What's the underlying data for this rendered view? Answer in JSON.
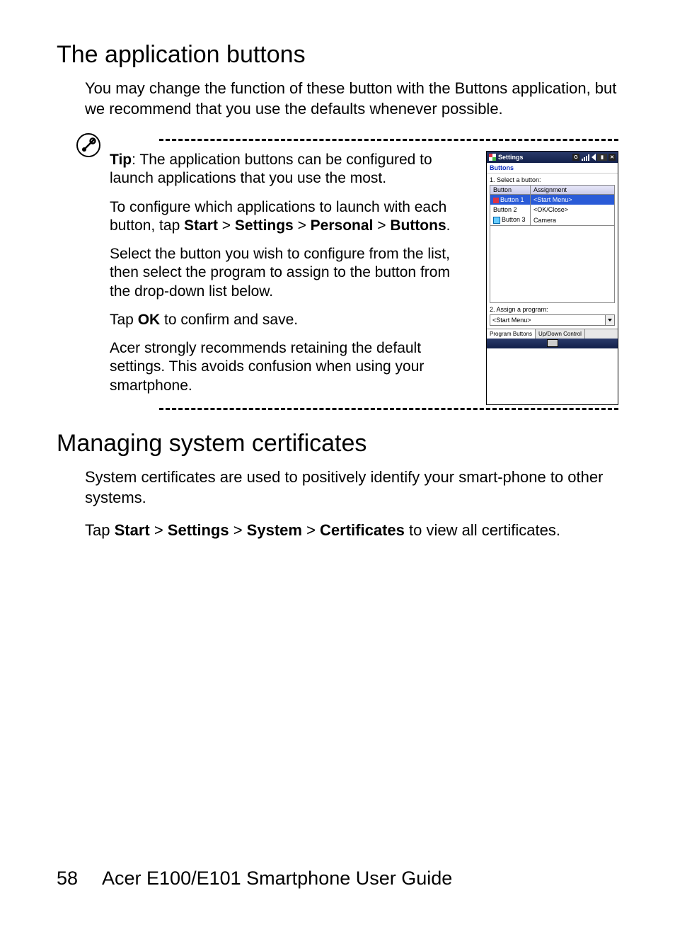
{
  "section1": {
    "heading": "The application buttons",
    "intro": "You may change the function of these button with the Buttons application, but we recommend that you use the defaults whenever possible."
  },
  "tip": {
    "label": "Tip",
    "p1_rest": ": The application buttons can be configured to launch applications that you use the most.",
    "p2_a": "To configure which applications to launch with each button, tap ",
    "p2_nav1": "Start",
    "p2_sep": " > ",
    "p2_nav2": "Settings",
    "p2_nav3": "Personal",
    "p2_nav4": "Buttons",
    "p2_end": ".",
    "p3": "Select the button you wish to configure from the list, then select the program to assign to the button from the drop-down list below.",
    "p4_a": "Tap ",
    "p4_ok": "OK",
    "p4_b": " to confirm and save.",
    "p5": "Acer strongly recommends retaining the default settings. This avoids confusion when using your smartphone."
  },
  "wm": {
    "title": "Settings",
    "g": "G",
    "subtitle": "Buttons",
    "step1": "1. Select a button:",
    "col1": "Button",
    "col2": "Assignment",
    "rows": [
      {
        "b": "Button 1",
        "a": "<Start Menu>"
      },
      {
        "b": "Button 2",
        "a": "<OK/Close>"
      },
      {
        "b": "Button 3",
        "a": "Camera"
      }
    ],
    "step2": "2. Assign a program:",
    "dropdown": "<Start Menu>",
    "tab1": "Program Buttons",
    "tab2": "Up/Down Control"
  },
  "section2": {
    "heading": "Managing system certificates",
    "p1": "System certificates are used to positively identify your smart-phone to other systems.",
    "p2_a": "Tap ",
    "nav1": "Start",
    "sep": " > ",
    "nav2": "Settings",
    "nav3": "System",
    "nav4": "Certificates",
    "p2_b": " to view all certificates."
  },
  "footer": {
    "page": "58",
    "title": "Acer E100/E101 Smartphone User Guide"
  }
}
